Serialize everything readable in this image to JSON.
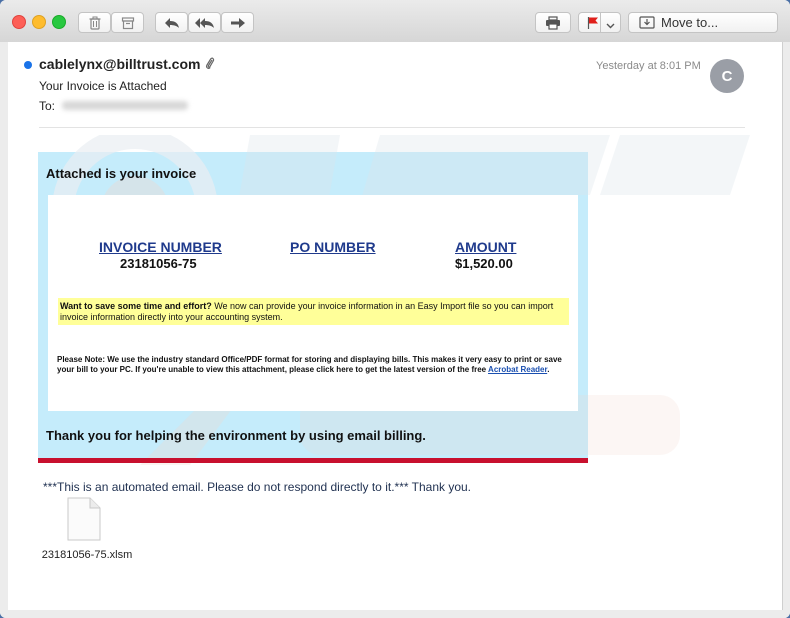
{
  "toolbar": {
    "move_label": "Move to..."
  },
  "icons": {
    "trash": "trash-icon",
    "archive": "archive-icon",
    "reply": "reply-icon",
    "reply_all": "reply-all-icon",
    "forward": "forward-icon",
    "print": "print-icon",
    "flag": "flag-icon",
    "move": "move-to-folder-icon",
    "attachment": "paperclip-icon",
    "file": "document-file-icon"
  },
  "email": {
    "sender": "cablelynx@billtrust.com",
    "date": "Yesterday at 8:01 PM",
    "avatar_initial": "C",
    "subject": "Your Invoice is Attached",
    "to_label": "To:"
  },
  "invoice": {
    "title": "Attached is your invoice",
    "columns": [
      {
        "header": "INVOICE NUMBER",
        "value": "23181056-75"
      },
      {
        "header": "PO NUMBER",
        "value": ""
      },
      {
        "header": "AMOUNT",
        "value": "$1,520.00"
      }
    ],
    "promo_bold": "Want to save some time and effort?",
    "promo_text": " We now can provide your invoice information in an Easy Import file so you can import invoice information directly into your accounting system.",
    "note_text": "Please Note: We use the industry standard Office/PDF format for storing and displaying bills. This makes it very easy to print or save your bill to your PC. If you're unable to view this attachment, please click here to get the latest version of the free ",
    "note_link": "Acrobat Reader",
    "note_end": ".",
    "thanks": "Thank you for helping the environment by using email billing."
  },
  "footer": {
    "automated": "***This is an automated email. Please do not respond directly to it.*** Thank you."
  },
  "attachment": {
    "filename": "23181056-75.xlsm"
  },
  "colors": {
    "accent_blue": "#1a73e8",
    "card_bg": "#c5ecfb",
    "highlight": "#ffff99",
    "red_bar": "#c8102e",
    "link": "#1f3a8c"
  }
}
